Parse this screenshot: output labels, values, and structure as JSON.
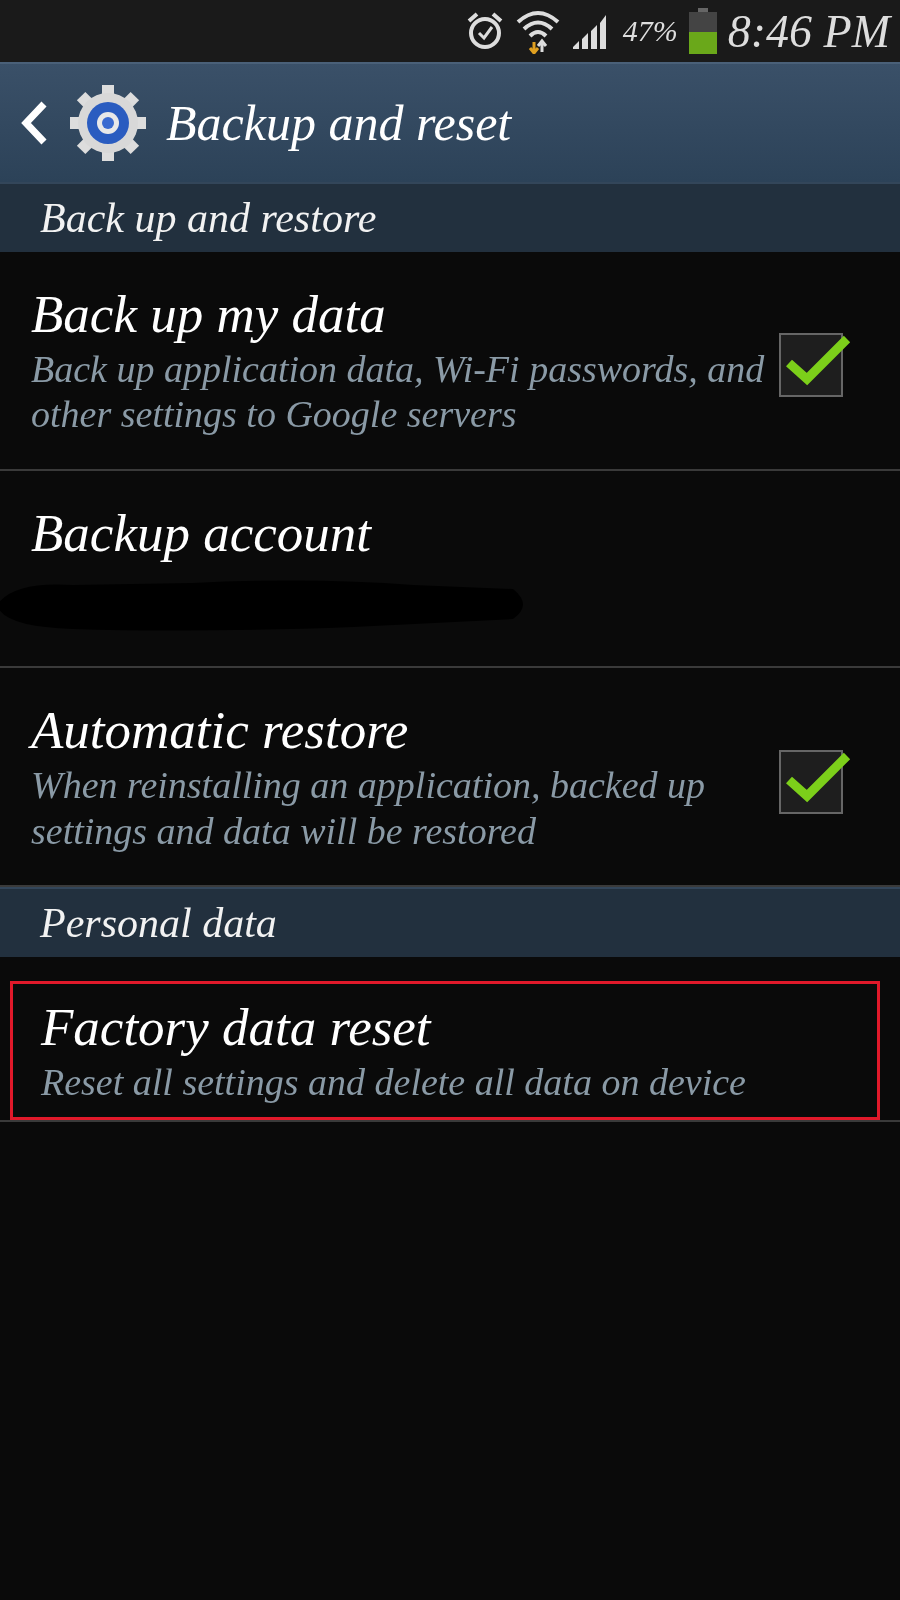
{
  "status_bar": {
    "battery": "47%",
    "time": "8:46 PM"
  },
  "header": {
    "title": "Backup and reset"
  },
  "sections": [
    {
      "title": "Back up and restore",
      "items": [
        {
          "kind": "checkbox",
          "title": "Back up my data",
          "summary": "Back up application data, Wi-Fi passwords, and other settings to Google servers",
          "checked": true,
          "highlighted": false
        },
        {
          "kind": "account",
          "title": "Backup account",
          "highlighted": false
        },
        {
          "kind": "checkbox",
          "title": "Automatic restore",
          "summary": "When reinstalling an application, backed up settings and data will be restored",
          "checked": true,
          "highlighted": false
        }
      ]
    },
    {
      "title": "Personal data",
      "items": [
        {
          "kind": "plain",
          "title": "Factory data reset",
          "summary": "Reset all settings and delete all data on device",
          "highlighted": true
        }
      ]
    }
  ]
}
